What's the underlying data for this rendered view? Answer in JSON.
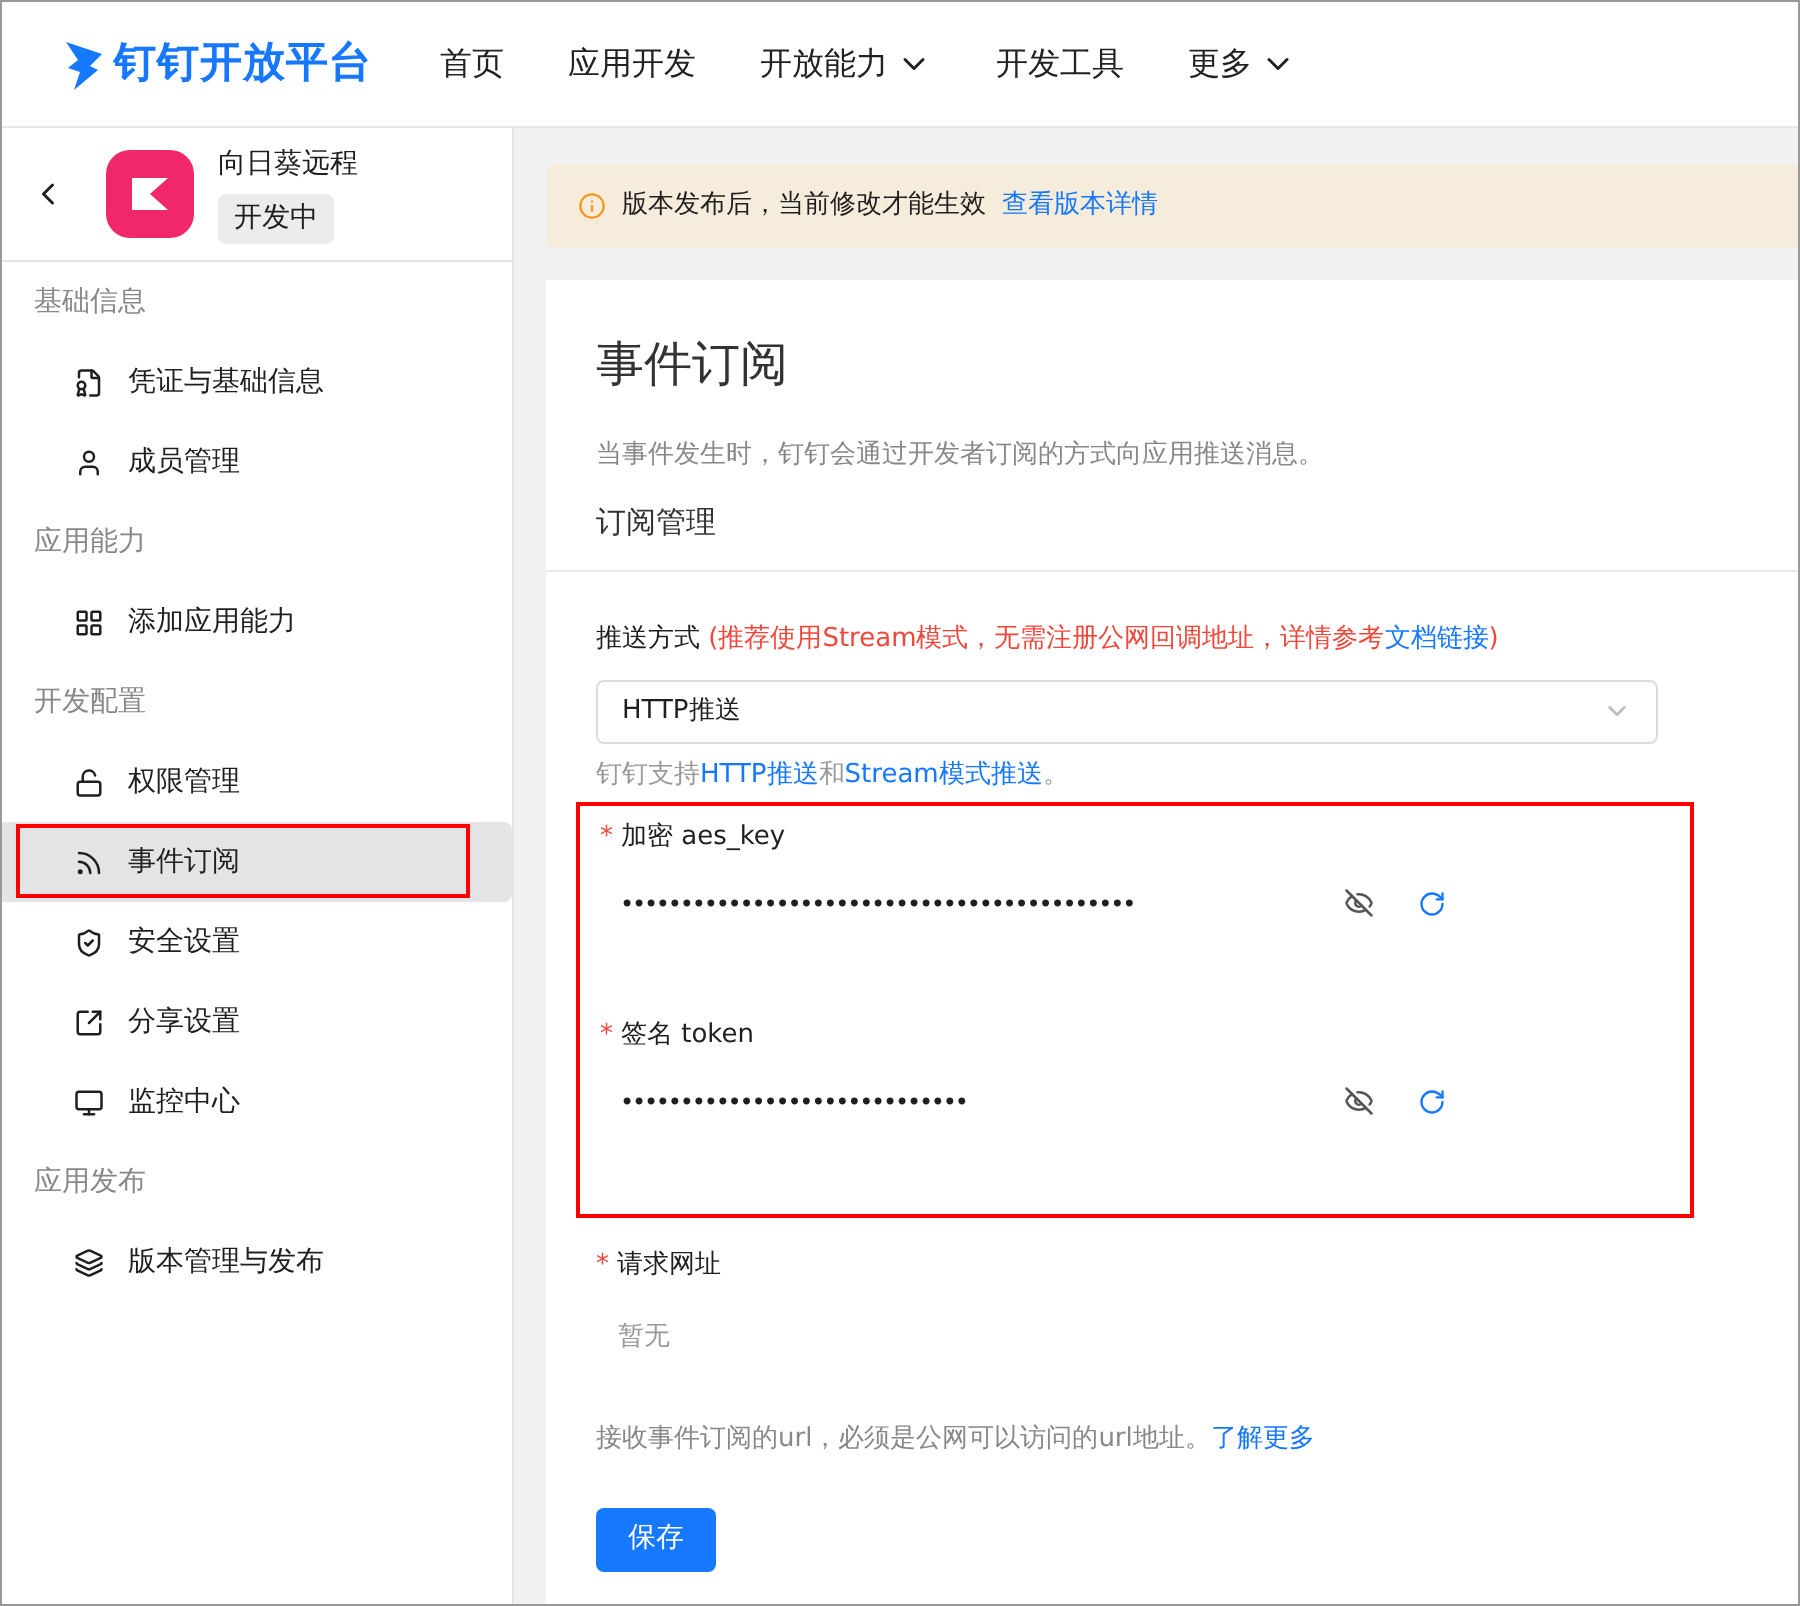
{
  "nav": {
    "logo": "钉钉开放平台",
    "items": [
      {
        "label": "首页",
        "dropdown": false
      },
      {
        "label": "应用开发",
        "dropdown": false
      },
      {
        "label": "开放能力",
        "dropdown": true
      },
      {
        "label": "开发工具",
        "dropdown": false
      },
      {
        "label": "更多",
        "dropdown": true
      }
    ]
  },
  "app": {
    "name": "向日葵远程",
    "status": "开发中"
  },
  "sidebar": {
    "groups": [
      {
        "title": "基础信息",
        "items": [
          {
            "label": "凭证与基础信息",
            "selected": false,
            "annotated": false
          },
          {
            "label": "成员管理",
            "selected": false,
            "annotated": false
          }
        ]
      },
      {
        "title": "应用能力",
        "items": [
          {
            "label": "添加应用能力",
            "selected": false,
            "annotated": false
          }
        ]
      },
      {
        "title": "开发配置",
        "items": [
          {
            "label": "权限管理",
            "selected": false,
            "annotated": false
          },
          {
            "label": "事件订阅",
            "selected": true,
            "annotated": true
          },
          {
            "label": "安全设置",
            "selected": false,
            "annotated": false
          },
          {
            "label": "分享设置",
            "selected": false,
            "annotated": false
          },
          {
            "label": "监控中心",
            "selected": false,
            "annotated": false
          }
        ]
      },
      {
        "title": "应用发布",
        "items": [
          {
            "label": "版本管理与发布",
            "selected": false,
            "annotated": false
          }
        ]
      }
    ]
  },
  "notice": {
    "text": "版本发布后，当前修改才能生效",
    "link": "查看版本详情"
  },
  "page": {
    "title": "事件订阅",
    "description": "当事件发生时，钉钉会通过开发者订阅的方式向应用推送消息。",
    "section": "订阅管理"
  },
  "push": {
    "label": "推送方式",
    "hint": "(推荐使用Stream模式，无需注册公网回调地址，详情参考",
    "hint_link": "文档链接",
    "hint_end": ")",
    "value": "HTTP推送",
    "help_prefix": "钉钉支持",
    "help_link1": "HTTP推送",
    "help_mid": "和",
    "help_link2": "Stream模式推送",
    "help_end": "。"
  },
  "secrets": {
    "annotated": true,
    "fields": [
      {
        "label": "加密 aes_key",
        "required_mark": "*",
        "value": "•••••••••••••••••••••••••••••••••••••••••••"
      },
      {
        "label": "签名 token",
        "required_mark": "*",
        "value": "•••••••••••••••••••••••••••••"
      }
    ]
  },
  "url": {
    "label": "请求网址",
    "required_mark": "*",
    "value": "暂无",
    "help": "接收事件订阅的url，必须是公网可以访问的url地址。",
    "help_link": "了解更多"
  },
  "save_button": "保存"
}
